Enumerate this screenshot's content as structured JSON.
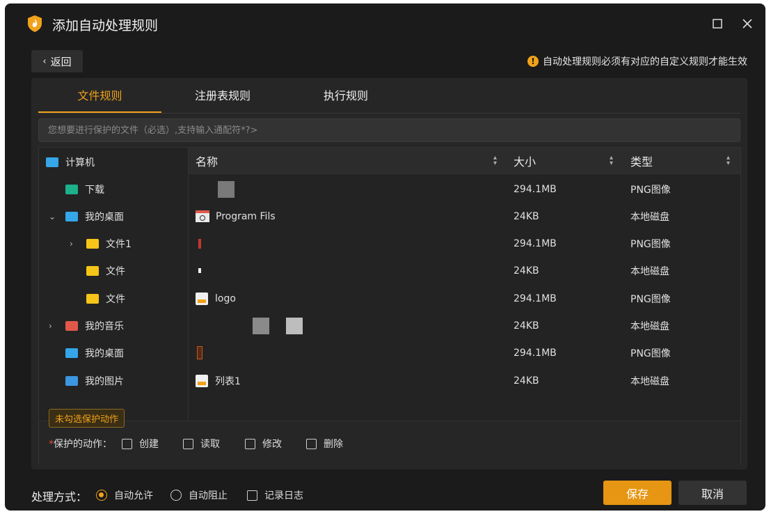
{
  "window": {
    "title": "添加自动处理规则"
  },
  "toolbar": {
    "back_label": "返回",
    "notice": "自动处理规则必须有对应的自定义规则才能生效"
  },
  "tabs": [
    {
      "label": "文件规则"
    },
    {
      "label": "注册表规则"
    },
    {
      "label": "执行规则"
    }
  ],
  "search": {
    "placeholder": "您想要进行保护的文件（必选）,支持输入通配符*?>"
  },
  "tree": [
    {
      "label": "计算机"
    },
    {
      "label": "下载"
    },
    {
      "label": "我的桌面"
    },
    {
      "label": "文件1"
    },
    {
      "label": "文件"
    },
    {
      "label": "文件"
    },
    {
      "label": "我的音乐"
    },
    {
      "label": "我的桌面"
    },
    {
      "label": "我的图片"
    }
  ],
  "table": {
    "columns": [
      {
        "label": "名称"
      },
      {
        "label": "大小"
      },
      {
        "label": "类型"
      }
    ],
    "rows": [
      {
        "name": "",
        "size": "294.1MB",
        "type": "PNG图像"
      },
      {
        "name": "Program Fils",
        "size": "24KB",
        "type": "本地磁盘"
      },
      {
        "name": "",
        "size": "294.1MB",
        "type": "PNG图像"
      },
      {
        "name": "",
        "size": "24KB",
        "type": "本地磁盘"
      },
      {
        "name": "logo",
        "size": "294.1MB",
        "type": "PNG图像"
      },
      {
        "name": "",
        "size": "24KB",
        "type": "本地磁盘"
      },
      {
        "name": "",
        "size": "294.1MB",
        "type": "PNG图像"
      },
      {
        "name": "列表1",
        "size": "24KB",
        "type": "本地磁盘"
      }
    ]
  },
  "actions": {
    "tooltip": "未勾选保护动作",
    "label": "保护的动作：",
    "required_mark": "*",
    "options": [
      {
        "label": "创建"
      },
      {
        "label": "读取"
      },
      {
        "label": "修改"
      },
      {
        "label": "删除"
      }
    ]
  },
  "footer": {
    "label": "处理方式：",
    "radios": [
      {
        "label": "自动允许",
        "selected": true
      },
      {
        "label": "自动阻止",
        "selected": false
      }
    ],
    "log_label": "记录日志",
    "save_label": "保存",
    "cancel_label": "取消"
  },
  "colors": {
    "accent": "#F0A21A",
    "background": "#1B1B1B",
    "panel": "#262626"
  }
}
